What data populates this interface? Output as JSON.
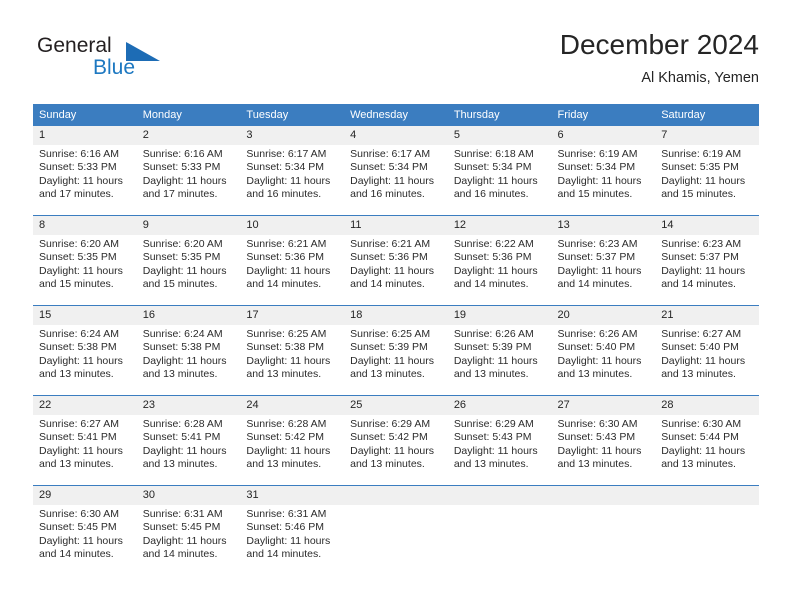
{
  "brand": {
    "name_part1": "General",
    "name_part2": "Blue",
    "logo_icon": "triangle-flag-icon"
  },
  "header": {
    "title": "December 2024",
    "subtitle": "Al Khamis, Yemen"
  },
  "weekday_headers": [
    "Sunday",
    "Monday",
    "Tuesday",
    "Wednesday",
    "Thursday",
    "Friday",
    "Saturday"
  ],
  "colors": {
    "header_blue": "#3b7dc0",
    "brand_blue": "#1d78c1",
    "daynum_bg": "#f0f0f0",
    "text": "#252525"
  },
  "labels": {
    "sunrise_prefix": "Sunrise: ",
    "sunset_prefix": "Sunset: ",
    "daylight_prefix": "Daylight: "
  },
  "weeks": [
    [
      {
        "day": "1",
        "sunrise": "Sunrise: 6:16 AM",
        "sunset": "Sunset: 5:33 PM",
        "daylight_line1": "Daylight: 11 hours",
        "daylight_line2": "and 17 minutes."
      },
      {
        "day": "2",
        "sunrise": "Sunrise: 6:16 AM",
        "sunset": "Sunset: 5:33 PM",
        "daylight_line1": "Daylight: 11 hours",
        "daylight_line2": "and 17 minutes."
      },
      {
        "day": "3",
        "sunrise": "Sunrise: 6:17 AM",
        "sunset": "Sunset: 5:34 PM",
        "daylight_line1": "Daylight: 11 hours",
        "daylight_line2": "and 16 minutes."
      },
      {
        "day": "4",
        "sunrise": "Sunrise: 6:17 AM",
        "sunset": "Sunset: 5:34 PM",
        "daylight_line1": "Daylight: 11 hours",
        "daylight_line2": "and 16 minutes."
      },
      {
        "day": "5",
        "sunrise": "Sunrise: 6:18 AM",
        "sunset": "Sunset: 5:34 PM",
        "daylight_line1": "Daylight: 11 hours",
        "daylight_line2": "and 16 minutes."
      },
      {
        "day": "6",
        "sunrise": "Sunrise: 6:19 AM",
        "sunset": "Sunset: 5:34 PM",
        "daylight_line1": "Daylight: 11 hours",
        "daylight_line2": "and 15 minutes."
      },
      {
        "day": "7",
        "sunrise": "Sunrise: 6:19 AM",
        "sunset": "Sunset: 5:35 PM",
        "daylight_line1": "Daylight: 11 hours",
        "daylight_line2": "and 15 minutes."
      }
    ],
    [
      {
        "day": "8",
        "sunrise": "Sunrise: 6:20 AM",
        "sunset": "Sunset: 5:35 PM",
        "daylight_line1": "Daylight: 11 hours",
        "daylight_line2": "and 15 minutes."
      },
      {
        "day": "9",
        "sunrise": "Sunrise: 6:20 AM",
        "sunset": "Sunset: 5:35 PM",
        "daylight_line1": "Daylight: 11 hours",
        "daylight_line2": "and 15 minutes."
      },
      {
        "day": "10",
        "sunrise": "Sunrise: 6:21 AM",
        "sunset": "Sunset: 5:36 PM",
        "daylight_line1": "Daylight: 11 hours",
        "daylight_line2": "and 14 minutes."
      },
      {
        "day": "11",
        "sunrise": "Sunrise: 6:21 AM",
        "sunset": "Sunset: 5:36 PM",
        "daylight_line1": "Daylight: 11 hours",
        "daylight_line2": "and 14 minutes."
      },
      {
        "day": "12",
        "sunrise": "Sunrise: 6:22 AM",
        "sunset": "Sunset: 5:36 PM",
        "daylight_line1": "Daylight: 11 hours",
        "daylight_line2": "and 14 minutes."
      },
      {
        "day": "13",
        "sunrise": "Sunrise: 6:23 AM",
        "sunset": "Sunset: 5:37 PM",
        "daylight_line1": "Daylight: 11 hours",
        "daylight_line2": "and 14 minutes."
      },
      {
        "day": "14",
        "sunrise": "Sunrise: 6:23 AM",
        "sunset": "Sunset: 5:37 PM",
        "daylight_line1": "Daylight: 11 hours",
        "daylight_line2": "and 14 minutes."
      }
    ],
    [
      {
        "day": "15",
        "sunrise": "Sunrise: 6:24 AM",
        "sunset": "Sunset: 5:38 PM",
        "daylight_line1": "Daylight: 11 hours",
        "daylight_line2": "and 13 minutes."
      },
      {
        "day": "16",
        "sunrise": "Sunrise: 6:24 AM",
        "sunset": "Sunset: 5:38 PM",
        "daylight_line1": "Daylight: 11 hours",
        "daylight_line2": "and 13 minutes."
      },
      {
        "day": "17",
        "sunrise": "Sunrise: 6:25 AM",
        "sunset": "Sunset: 5:38 PM",
        "daylight_line1": "Daylight: 11 hours",
        "daylight_line2": "and 13 minutes."
      },
      {
        "day": "18",
        "sunrise": "Sunrise: 6:25 AM",
        "sunset": "Sunset: 5:39 PM",
        "daylight_line1": "Daylight: 11 hours",
        "daylight_line2": "and 13 minutes."
      },
      {
        "day": "19",
        "sunrise": "Sunrise: 6:26 AM",
        "sunset": "Sunset: 5:39 PM",
        "daylight_line1": "Daylight: 11 hours",
        "daylight_line2": "and 13 minutes."
      },
      {
        "day": "20",
        "sunrise": "Sunrise: 6:26 AM",
        "sunset": "Sunset: 5:40 PM",
        "daylight_line1": "Daylight: 11 hours",
        "daylight_line2": "and 13 minutes."
      },
      {
        "day": "21",
        "sunrise": "Sunrise: 6:27 AM",
        "sunset": "Sunset: 5:40 PM",
        "daylight_line1": "Daylight: 11 hours",
        "daylight_line2": "and 13 minutes."
      }
    ],
    [
      {
        "day": "22",
        "sunrise": "Sunrise: 6:27 AM",
        "sunset": "Sunset: 5:41 PM",
        "daylight_line1": "Daylight: 11 hours",
        "daylight_line2": "and 13 minutes."
      },
      {
        "day": "23",
        "sunrise": "Sunrise: 6:28 AM",
        "sunset": "Sunset: 5:41 PM",
        "daylight_line1": "Daylight: 11 hours",
        "daylight_line2": "and 13 minutes."
      },
      {
        "day": "24",
        "sunrise": "Sunrise: 6:28 AM",
        "sunset": "Sunset: 5:42 PM",
        "daylight_line1": "Daylight: 11 hours",
        "daylight_line2": "and 13 minutes."
      },
      {
        "day": "25",
        "sunrise": "Sunrise: 6:29 AM",
        "sunset": "Sunset: 5:42 PM",
        "daylight_line1": "Daylight: 11 hours",
        "daylight_line2": "and 13 minutes."
      },
      {
        "day": "26",
        "sunrise": "Sunrise: 6:29 AM",
        "sunset": "Sunset: 5:43 PM",
        "daylight_line1": "Daylight: 11 hours",
        "daylight_line2": "and 13 minutes."
      },
      {
        "day": "27",
        "sunrise": "Sunrise: 6:30 AM",
        "sunset": "Sunset: 5:43 PM",
        "daylight_line1": "Daylight: 11 hours",
        "daylight_line2": "and 13 minutes."
      },
      {
        "day": "28",
        "sunrise": "Sunrise: 6:30 AM",
        "sunset": "Sunset: 5:44 PM",
        "daylight_line1": "Daylight: 11 hours",
        "daylight_line2": "and 13 minutes."
      }
    ],
    [
      {
        "day": "29",
        "sunrise": "Sunrise: 6:30 AM",
        "sunset": "Sunset: 5:45 PM",
        "daylight_line1": "Daylight: 11 hours",
        "daylight_line2": "and 14 minutes."
      },
      {
        "day": "30",
        "sunrise": "Sunrise: 6:31 AM",
        "sunset": "Sunset: 5:45 PM",
        "daylight_line1": "Daylight: 11 hours",
        "daylight_line2": "and 14 minutes."
      },
      {
        "day": "31",
        "sunrise": "Sunrise: 6:31 AM",
        "sunset": "Sunset: 5:46 PM",
        "daylight_line1": "Daylight: 11 hours",
        "daylight_line2": "and 14 minutes."
      },
      {
        "day": "",
        "sunrise": "",
        "sunset": "",
        "daylight_line1": "",
        "daylight_line2": ""
      },
      {
        "day": "",
        "sunrise": "",
        "sunset": "",
        "daylight_line1": "",
        "daylight_line2": ""
      },
      {
        "day": "",
        "sunrise": "",
        "sunset": "",
        "daylight_line1": "",
        "daylight_line2": ""
      },
      {
        "day": "",
        "sunrise": "",
        "sunset": "",
        "daylight_line1": "",
        "daylight_line2": ""
      }
    ]
  ]
}
